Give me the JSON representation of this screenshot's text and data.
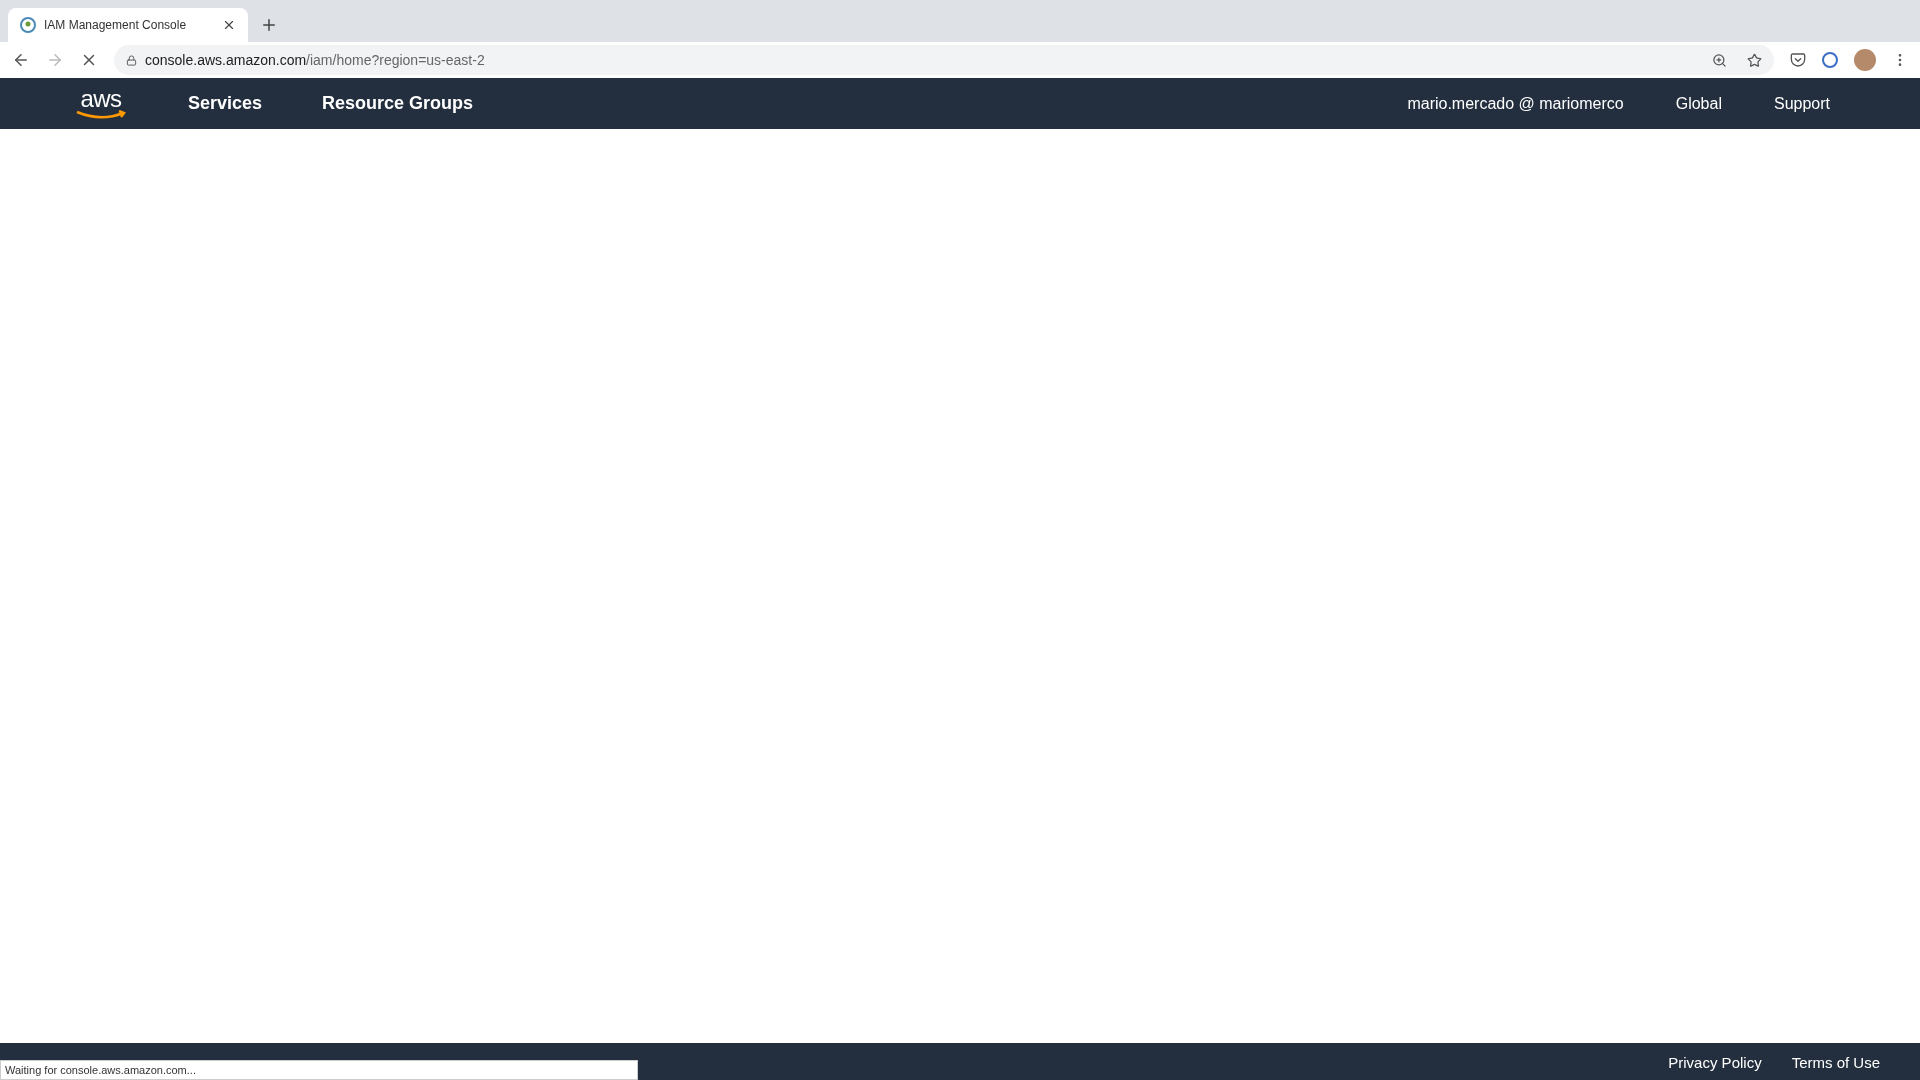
{
  "browser": {
    "tab": {
      "title": "IAM Management Console",
      "selected": true
    },
    "url_host": "console.aws.amazon.com",
    "url_path": "/iam/home?region=us-east-2",
    "loading": true
  },
  "nav": {
    "logo": "aws",
    "items": [
      "Services",
      "Resource Groups"
    ],
    "account": "mario.mercado @ mariomerco",
    "region": "Global",
    "support": "Support"
  },
  "footer": {
    "right": [
      "Privacy Policy",
      "Terms of Use"
    ]
  },
  "status_bubble": "Waiting for console.aws.amazon.com..."
}
